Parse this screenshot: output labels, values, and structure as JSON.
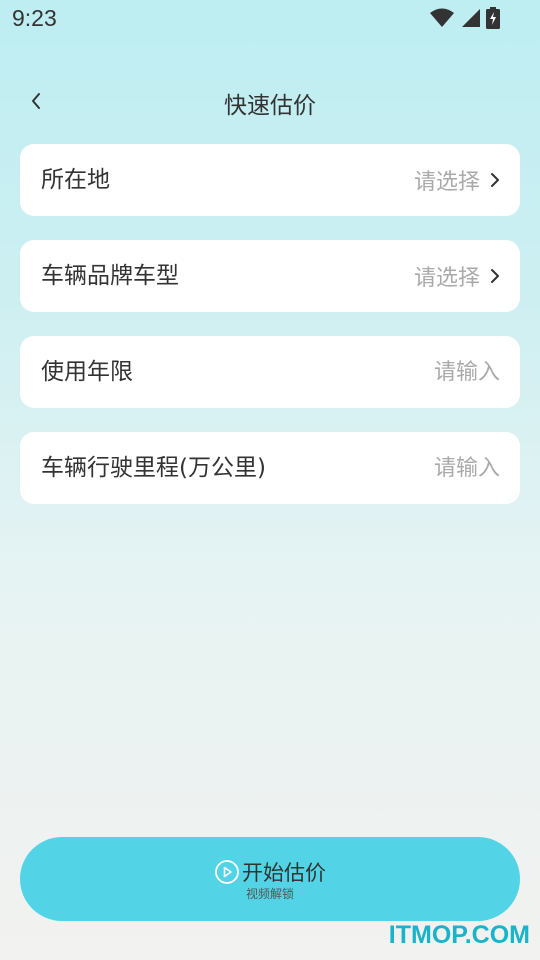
{
  "status_bar": {
    "time": "9:23",
    "icons": [
      "wifi-icon",
      "signal-icon",
      "battery-charging-icon"
    ]
  },
  "header": {
    "title": "快速估价",
    "back_icon": "chevron-left-icon"
  },
  "form": {
    "location": {
      "label": "所在地",
      "value": "请选择"
    },
    "brand_model": {
      "label": "车辆品牌车型",
      "value": "请选择"
    },
    "years_used": {
      "label": "使用年限",
      "placeholder": "请输入"
    },
    "mileage": {
      "label": "车辆行驶里程(万公里)",
      "placeholder": "请输入"
    }
  },
  "start_button": {
    "label": "开始估价",
    "sublabel": "视频解锁",
    "icon": "play-circle-icon"
  },
  "watermark": "ITMOP.COM",
  "colors": {
    "accent": "#52d4e6",
    "card_bg": "#ffffff",
    "text": "#333333",
    "placeholder": "#aaaaaa",
    "watermark": "#19b3ca"
  }
}
